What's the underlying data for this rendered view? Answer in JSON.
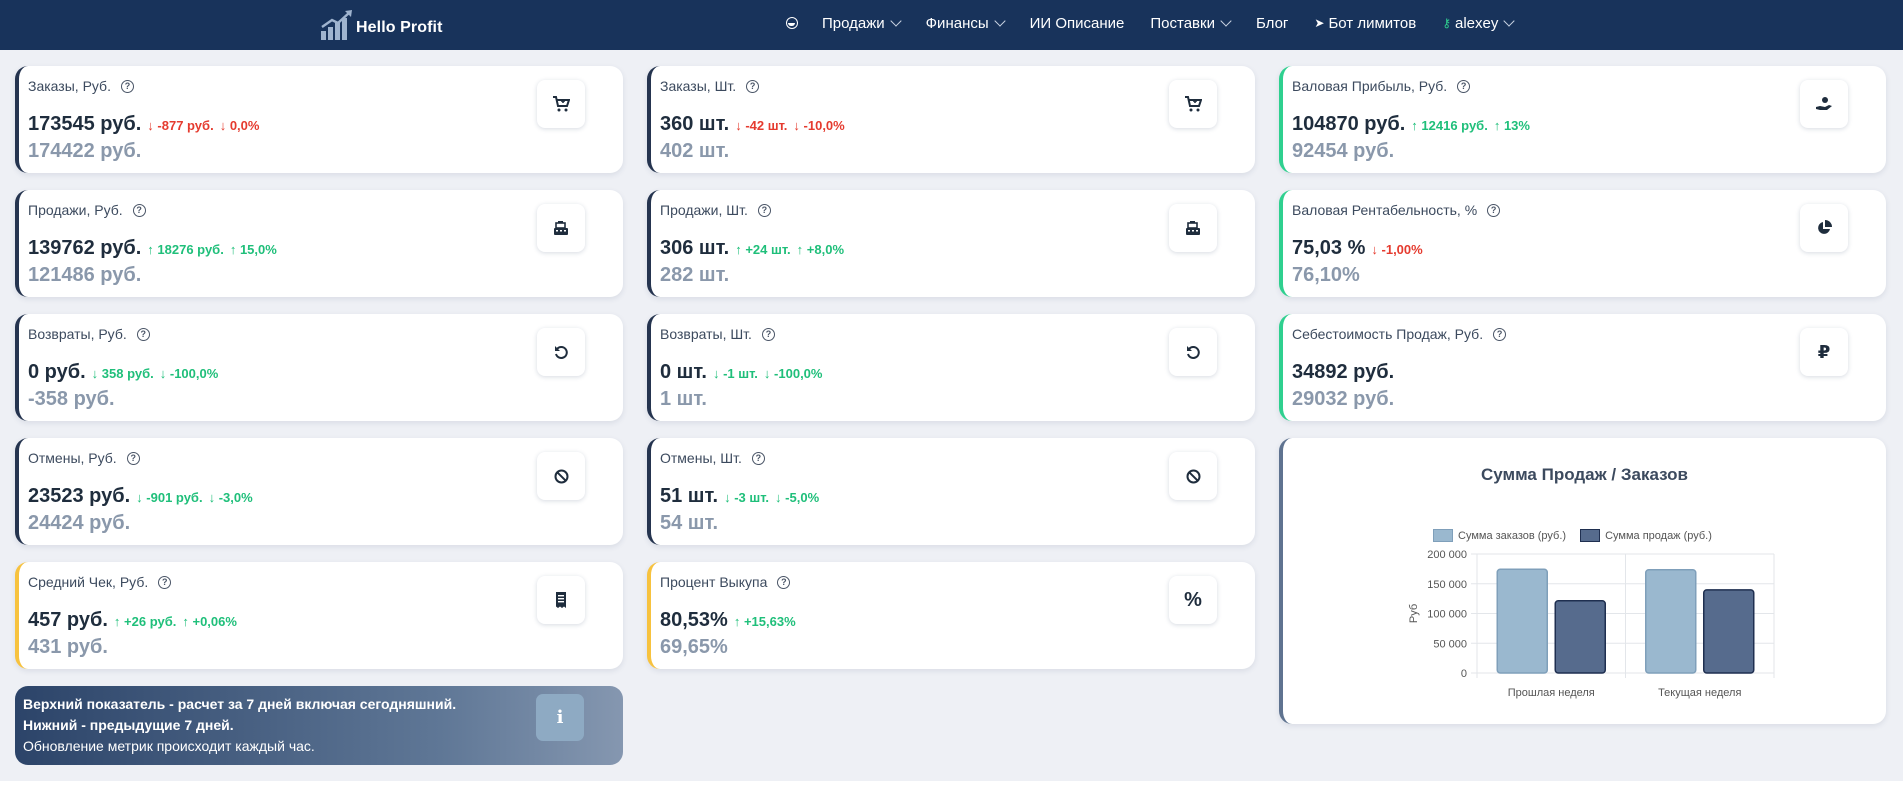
{
  "brand": {
    "name": "Hello Profit"
  },
  "nav": {
    "items": [
      {
        "label": "Продажи",
        "has_dropdown": true
      },
      {
        "label": "Финансы",
        "has_dropdown": true
      },
      {
        "label": "ИИ Описание",
        "has_dropdown": false
      },
      {
        "label": "Поставки",
        "has_dropdown": true
      },
      {
        "label": "Блог",
        "has_dropdown": false
      },
      {
        "label": "Бот лимитов",
        "has_dropdown": false,
        "icon": "send-icon"
      },
      {
        "label": "alexey",
        "has_dropdown": true,
        "icon": "key-icon"
      }
    ]
  },
  "cards": {
    "orders_rub": {
      "title": "Заказы, Руб.",
      "value": "173545 руб.",
      "delta_abs": "-877 руб.",
      "delta_pct": "0,0%",
      "direction": "down",
      "color": "red",
      "prev": "174422 руб.",
      "icon": "cart-icon"
    },
    "orders_pcs": {
      "title": "Заказы, Шт.",
      "value": "360 шт.",
      "delta_abs": "-42 шт.",
      "delta_pct": "-10,0%",
      "direction": "down",
      "color": "red",
      "prev": "402 шт.",
      "icon": "cart-icon"
    },
    "gross_profit": {
      "title": "Валовая Прибыль, Руб.",
      "value": "104870 руб.",
      "delta_abs": "12416 руб.",
      "delta_pct": "13%",
      "direction": "up",
      "color": "green",
      "prev": "92454 руб.",
      "icon": "hand-coin-icon"
    },
    "sales_rub": {
      "title": "Продажи, Руб.",
      "value": "139762 руб.",
      "delta_abs": "18276 руб.",
      "delta_pct": "15,0%",
      "direction": "up",
      "color": "green",
      "prev": "121486 руб.",
      "icon": "cash-register-icon"
    },
    "sales_pcs": {
      "title": "Продажи, Шт.",
      "value": "306 шт.",
      "delta_abs": "+24 шт.",
      "delta_pct": "+8,0%",
      "direction": "up",
      "color": "green",
      "prev": "282 шт.",
      "icon": "cash-register-icon"
    },
    "gross_margin": {
      "title": "Валовая Рентабельность, %",
      "value": "75,03 %",
      "delta_abs": "-1,00%",
      "delta_pct": "",
      "direction": "down",
      "color": "red",
      "prev": "76,10%",
      "icon": "pie-chart-icon"
    },
    "returns_rub": {
      "title": "Возвраты, Руб.",
      "value": "0 руб.",
      "delta_abs": "358 руб.",
      "delta_pct": "-100,0%",
      "direction": "down",
      "color": "green",
      "prev": "-358 руб.",
      "icon": "undo-icon"
    },
    "returns_pcs": {
      "title": "Возвраты, Шт.",
      "value": "0 шт.",
      "delta_abs": "-1 шт.",
      "delta_pct": "-100,0%",
      "direction": "down",
      "color": "green",
      "prev": "1 шт.",
      "icon": "undo-icon"
    },
    "cogs": {
      "title": "Себестоимость Продаж, Руб.",
      "value": "34892 руб.",
      "delta_abs": "",
      "delta_pct": "",
      "direction": "none",
      "color": "green",
      "prev": "29032 руб.",
      "icon": "ruble-icon"
    },
    "cancels_rub": {
      "title": "Отмены, Руб.",
      "value": "23523 руб.",
      "delta_abs": "-901 руб.",
      "delta_pct": "-3,0%",
      "direction": "down",
      "color": "green",
      "prev": "24424 руб.",
      "icon": "ban-icon"
    },
    "cancels_pcs": {
      "title": "Отмены, Шт.",
      "value": "51 шт.",
      "delta_abs": "-3 шт.",
      "delta_pct": "-5,0%",
      "direction": "down",
      "color": "green",
      "prev": "54 шт.",
      "icon": "ban-icon"
    },
    "avg_check": {
      "title": "Средний Чек, Руб.",
      "value": "457 руб.",
      "delta_abs": "+26 руб.",
      "delta_pct": "+0,06%",
      "direction": "up",
      "color": "green",
      "prev": "431 руб.",
      "icon": "receipt-icon"
    },
    "buyout": {
      "title": "Процент Выкупа",
      "value": "80,53%",
      "delta_abs": "+15,63%",
      "delta_pct": "",
      "direction": "up",
      "color": "green",
      "prev": "69,65%",
      "icon": "percent-icon"
    }
  },
  "info": {
    "line1": "Верхний показатель - расчет за 7 дней включая сегодняшний.",
    "line2": "Нижний - предыдущие 7 дней.",
    "line3": "Обновление метрик происходит каждый час.",
    "icon_label": "i"
  },
  "colors": {
    "up": "#1fbf7a",
    "down": "#e53b2f",
    "navbar": "#18335b"
  },
  "chart_data": {
    "type": "bar",
    "title": "Сумма Продаж / Заказов",
    "categories": [
      "Прошлая неделя",
      "Текущая неделя"
    ],
    "series": [
      {
        "name": "Сумма заказов (руб.)",
        "values": [
          174422,
          173545
        ],
        "fill": "#9ab8cf",
        "stroke": "#7f9fba"
      },
      {
        "name": "Сумма продаж (руб.)",
        "values": [
          121486,
          139762
        ],
        "fill": "#566b8d",
        "stroke": "#1f2f50"
      }
    ],
    "ylabel": "Руб",
    "ylim": [
      0,
      200000
    ],
    "yticks": [
      0,
      50000,
      100000,
      150000,
      200000
    ],
    "ytick_labels": [
      "0",
      "50 000",
      "100 000",
      "150 000",
      "200 000"
    ],
    "grid": true,
    "legend": "top"
  }
}
